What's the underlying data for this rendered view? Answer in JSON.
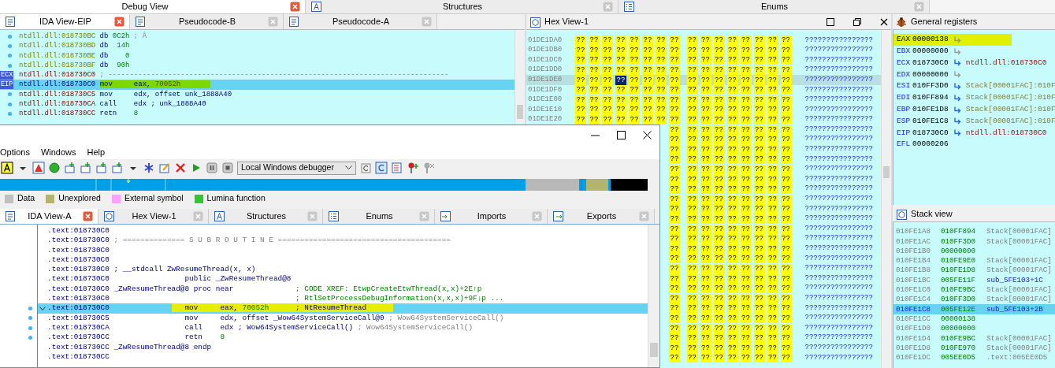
{
  "top_tabs": [
    {
      "label": "Debug View",
      "kind": "none",
      "selected": true
    },
    {
      "label": "Structures",
      "kind": "structures",
      "selected": false
    },
    {
      "label": "Enums",
      "kind": "enums",
      "selected": false
    }
  ],
  "eip_view": {
    "tabs": [
      {
        "label": "IDA View-EIP",
        "kind": "disassembly",
        "selected": true
      },
      {
        "label": "Pseudocode-B",
        "kind": "disassembly",
        "selected": false
      },
      {
        "label": "Pseudocode-A",
        "kind": "disassembly",
        "selected": false
      }
    ],
    "lines": [
      {
        "dot": true,
        "current": false,
        "parts": [
          {
            "text": "ntdll.dll:018730BC",
            "kind": "addrdata"
          },
          {
            "text": " db ",
            "kind": "keyword"
          },
          {
            "text": "0C2h",
            "kind": "number"
          },
          {
            "text": " ; Â",
            "kind": "comment"
          }
        ]
      },
      {
        "dot": true,
        "current": false,
        "parts": [
          {
            "text": "ntdll.dll:018730BD",
            "kind": "addrdata"
          },
          {
            "text": " db  ",
            "kind": "keyword"
          },
          {
            "text": "14h",
            "kind": "number"
          }
        ]
      },
      {
        "dot": true,
        "current": false,
        "parts": [
          {
            "text": "ntdll.dll:018730BE",
            "kind": "addrdata"
          },
          {
            "text": " db    ",
            "kind": "keyword"
          },
          {
            "text": "0",
            "kind": "number"
          }
        ]
      },
      {
        "dot": true,
        "current": false,
        "parts": [
          {
            "text": "ntdll.dll:018730BF",
            "kind": "addrdata"
          },
          {
            "text": " db  ",
            "kind": "keyword"
          },
          {
            "text": "90h",
            "kind": "number"
          }
        ]
      },
      {
        "dot": false,
        "register_label": "ECX",
        "current": false,
        "parts": [
          {
            "text": "ntdll.dll:018730C0",
            "kind": "addrcode"
          },
          {
            "text": " ; --------------------------------------------------------------------------------",
            "kind": "comment"
          }
        ]
      },
      {
        "dot": false,
        "register_label": "EIP",
        "current": true,
        "parts": [
          {
            "text": "ntdll.dll:018730C0 ",
            "kind": "addrcur"
          },
          {
            "text": "mov     eax, ",
            "kind": "keywordmarked"
          },
          {
            "text": "70052h       ",
            "kind": "numbermarked"
          }
        ]
      },
      {
        "dot": true,
        "current": false,
        "parts": [
          {
            "text": "ntdll.dll:018730C5",
            "kind": "addrcode"
          },
          {
            "text": " mov     edx, offset unk_1888A40",
            "kind": "keyword"
          }
        ]
      },
      {
        "dot": true,
        "current": false,
        "parts": [
          {
            "text": "ntdll.dll:018730CA",
            "kind": "addrcode"
          },
          {
            "text": " call    edx ; unk_1888A40",
            "kind": "keyword"
          }
        ]
      },
      {
        "dot": true,
        "current": false,
        "parts": [
          {
            "text": "ntdll.dll:018730CC",
            "kind": "addrcode"
          },
          {
            "text": " retn    ",
            "kind": "keyword"
          },
          {
            "text": "8",
            "kind": "number"
          }
        ]
      }
    ]
  },
  "hex_view": {
    "title": "Hex View-1",
    "rows": [
      {
        "address": "01DE1DA0",
        "current": false,
        "ascii": "????????????????",
        "bytes": [
          {
            "t": "??",
            "selected": false
          },
          {
            "t": "??",
            "selected": false
          },
          {
            "t": "??",
            "selected": false
          },
          {
            "t": "??",
            "selected": false
          },
          {
            "t": "??",
            "selected": false
          },
          {
            "t": "??",
            "selected": false
          },
          {
            "t": "??",
            "selected": false
          },
          {
            "t": "??",
            "selected": false
          },
          {
            "t": "??",
            "selected": false
          },
          {
            "t": "??",
            "selected": false
          },
          {
            "t": "??",
            "selected": false
          },
          {
            "t": "??",
            "selected": false
          },
          {
            "t": "??",
            "selected": false
          },
          {
            "t": "??",
            "selected": false
          },
          {
            "t": "??",
            "selected": false
          },
          {
            "t": "??",
            "selected": false
          }
        ]
      },
      {
        "address": "01DE1DB0",
        "current": false,
        "ascii": "????????????????",
        "bytes": [
          {
            "t": "??",
            "selected": false
          },
          {
            "t": "??",
            "selected": false
          },
          {
            "t": "??",
            "selected": false
          },
          {
            "t": "??",
            "selected": false
          },
          {
            "t": "??",
            "selected": false
          },
          {
            "t": "??",
            "selected": false
          },
          {
            "t": "??",
            "selected": false
          },
          {
            "t": "??",
            "selected": false
          },
          {
            "t": "??",
            "selected": false
          },
          {
            "t": "??",
            "selected": false
          },
          {
            "t": "??",
            "selected": false
          },
          {
            "t": "??",
            "selected": false
          },
          {
            "t": "??",
            "selected": false
          },
          {
            "t": "??",
            "selected": false
          },
          {
            "t": "??",
            "selected": false
          },
          {
            "t": "??",
            "selected": false
          }
        ]
      },
      {
        "address": "01DE1DC0",
        "current": false,
        "ascii": "????????????????",
        "bytes": [
          {
            "t": "??",
            "selected": false
          },
          {
            "t": "??",
            "selected": false
          },
          {
            "t": "??",
            "selected": false
          },
          {
            "t": "??",
            "selected": false
          },
          {
            "t": "??",
            "selected": false
          },
          {
            "t": "??",
            "selected": false
          },
          {
            "t": "??",
            "selected": false
          },
          {
            "t": "??",
            "selected": false
          },
          {
            "t": "??",
            "selected": false
          },
          {
            "t": "??",
            "selected": false
          },
          {
            "t": "??",
            "selected": false
          },
          {
            "t": "??",
            "selected": false
          },
          {
            "t": "??",
            "selected": false
          },
          {
            "t": "??",
            "selected": false
          },
          {
            "t": "??",
            "selected": false
          },
          {
            "t": "??",
            "selected": false
          }
        ]
      },
      {
        "address": "01DE1DD0",
        "current": false,
        "ascii": "????????????????",
        "bytes": [
          {
            "t": "??",
            "selected": false
          },
          {
            "t": "??",
            "selected": false
          },
          {
            "t": "??",
            "selected": false
          },
          {
            "t": "??",
            "selected": false
          },
          {
            "t": "??",
            "selected": false
          },
          {
            "t": "??",
            "selected": false
          },
          {
            "t": "??",
            "selected": false
          },
          {
            "t": "??",
            "selected": false
          },
          {
            "t": "??",
            "selected": false
          },
          {
            "t": "??",
            "selected": false
          },
          {
            "t": "??",
            "selected": false
          },
          {
            "t": "??",
            "selected": false
          },
          {
            "t": "??",
            "selected": false
          },
          {
            "t": "??",
            "selected": false
          },
          {
            "t": "??",
            "selected": false
          },
          {
            "t": "??",
            "selected": false
          }
        ]
      },
      {
        "address": "01DE1DE0",
        "current": true,
        "ascii": "????????????????",
        "bytes": [
          {
            "t": "??",
            "selected": false
          },
          {
            "t": "??",
            "selected": false
          },
          {
            "t": "??",
            "selected": false
          },
          {
            "t": "??",
            "selected": true
          },
          {
            "t": "??",
            "selected": false
          },
          {
            "t": "??",
            "selected": false
          },
          {
            "t": "??",
            "selected": false
          },
          {
            "t": "??",
            "selected": false
          },
          {
            "t": "??",
            "selected": false
          },
          {
            "t": "??",
            "selected": false
          },
          {
            "t": "??",
            "selected": false
          },
          {
            "t": "??",
            "selected": false
          },
          {
            "t": "??",
            "selected": false
          },
          {
            "t": "??",
            "selected": false
          },
          {
            "t": "??",
            "selected": false
          },
          {
            "t": "??",
            "selected": false
          }
        ]
      },
      {
        "address": "01DE1DF0",
        "current": false,
        "ascii": "????????????????",
        "bytes": [
          {
            "t": "??",
            "selected": false
          },
          {
            "t": "??",
            "selected": false
          },
          {
            "t": "??",
            "selected": false
          },
          {
            "t": "??",
            "selected": false
          },
          {
            "t": "??",
            "selected": false
          },
          {
            "t": "??",
            "selected": false
          },
          {
            "t": "??",
            "selected": false
          },
          {
            "t": "??",
            "selected": false
          },
          {
            "t": "??",
            "selected": false
          },
          {
            "t": "??",
            "selected": false
          },
          {
            "t": "??",
            "selected": false
          },
          {
            "t": "??",
            "selected": false
          },
          {
            "t": "??",
            "selected": false
          },
          {
            "t": "??",
            "selected": false
          },
          {
            "t": "??",
            "selected": false
          },
          {
            "t": "??",
            "selected": false
          }
        ]
      },
      {
        "address": "01DE1E00",
        "current": false,
        "ascii": "????????????????",
        "bytes": [
          {
            "t": "??",
            "selected": false
          },
          {
            "t": "??",
            "selected": false
          },
          {
            "t": "??",
            "selected": false
          },
          {
            "t": "??",
            "selected": false
          },
          {
            "t": "??",
            "selected": false
          },
          {
            "t": "??",
            "selected": false
          },
          {
            "t": "??",
            "selected": false
          },
          {
            "t": "??",
            "selected": false
          },
          {
            "t": "??",
            "selected": false
          },
          {
            "t": "??",
            "selected": false
          },
          {
            "t": "??",
            "selected": false
          },
          {
            "t": "??",
            "selected": false
          },
          {
            "t": "??",
            "selected": false
          },
          {
            "t": "??",
            "selected": false
          },
          {
            "t": "??",
            "selected": false
          },
          {
            "t": "??",
            "selected": false
          }
        ]
      },
      {
        "address": "01DE1E10",
        "current": false,
        "ascii": "????????????????",
        "bytes": [
          {
            "t": "??",
            "selected": false
          },
          {
            "t": "??",
            "selected": false
          },
          {
            "t": "??",
            "selected": false
          },
          {
            "t": "??",
            "selected": false
          },
          {
            "t": "??",
            "selected": false
          },
          {
            "t": "??",
            "selected": false
          },
          {
            "t": "??",
            "selected": false
          },
          {
            "t": "??",
            "selected": false
          },
          {
            "t": "??",
            "selected": false
          },
          {
            "t": "??",
            "selected": false
          },
          {
            "t": "??",
            "selected": false
          },
          {
            "t": "??",
            "selected": false
          },
          {
            "t": "??",
            "selected": false
          },
          {
            "t": "??",
            "selected": false
          },
          {
            "t": "??",
            "selected": false
          },
          {
            "t": "??",
            "selected": false
          }
        ]
      },
      {
        "address": "01DE1E20",
        "current": false,
        "ascii": "????????????????",
        "bytes": [
          {
            "t": "??",
            "selected": false
          },
          {
            "t": "??",
            "selected": false
          },
          {
            "t": "??",
            "selected": false
          },
          {
            "t": "??",
            "selected": false
          },
          {
            "t": "??",
            "selected": false
          },
          {
            "t": "??",
            "selected": false
          },
          {
            "t": "??",
            "selected": false
          },
          {
            "t": "??",
            "selected": false
          },
          {
            "t": "??",
            "selected": false
          },
          {
            "t": "??",
            "selected": false
          },
          {
            "t": "??",
            "selected": false
          },
          {
            "t": "??",
            "selected": false
          },
          {
            "t": "??",
            "selected": false
          },
          {
            "t": "??",
            "selected": false
          },
          {
            "t": "??",
            "selected": false
          },
          {
            "t": "??",
            "selected": false
          }
        ]
      }
    ],
    "partial_rows": [
      {
        "ascii": "????????????????",
        "bytes": [
          "??",
          "??",
          "??",
          "??",
          "??",
          "??",
          "??",
          "??",
          "??"
        ]
      },
      {
        "ascii": "????????????????",
        "bytes": [
          "??",
          "??",
          "??",
          "??",
          "??",
          "??",
          "??",
          "??",
          "??"
        ]
      },
      {
        "ascii": "????????????????",
        "bytes": [
          "??",
          "??",
          "??",
          "??",
          "??",
          "??",
          "??",
          "??",
          "??"
        ]
      },
      {
        "ascii": "????????????????",
        "bytes": [
          "??",
          "??",
          "??",
          "??",
          "??",
          "??",
          "??",
          "??",
          "??"
        ]
      },
      {
        "ascii": "????????????????",
        "bytes": [
          "??",
          "??",
          "??",
          "??",
          "??",
          "??",
          "??",
          "??",
          "??"
        ]
      },
      {
        "ascii": "????????????????",
        "bytes": [
          "??",
          "??",
          "??",
          "??",
          "??",
          "??",
          "??",
          "??",
          "??"
        ]
      },
      {
        "ascii": "????????????????",
        "bytes": [
          "??",
          "??",
          "??",
          "??",
          "??",
          "??",
          "??",
          "??",
          "??"
        ]
      },
      {
        "ascii": "????????????????",
        "bytes": [
          "??",
          "??",
          "??",
          "??",
          "??",
          "??",
          "??",
          "??",
          "??"
        ]
      },
      {
        "ascii": "????????????????",
        "bytes": [
          "??",
          "??",
          "??",
          "??",
          "??",
          "??",
          "??",
          "??",
          "??"
        ]
      },
      {
        "ascii": "????????????????",
        "bytes": [
          "??",
          "??",
          "??",
          "??",
          "??",
          "??",
          "??",
          "??",
          "??"
        ]
      },
      {
        "ascii": "????????????????",
        "bytes": [
          "??",
          "??",
          "??",
          "??",
          "??",
          "??",
          "??",
          "??",
          "??"
        ]
      },
      {
        "ascii": "????????????????",
        "bytes": [
          "??",
          "??",
          "??",
          "??",
          "??",
          "??",
          "??",
          "??",
          "??"
        ]
      },
      {
        "ascii": "????????????????",
        "bytes": [
          "??",
          "??",
          "??",
          "??",
          "??",
          "??",
          "??",
          "??",
          "??"
        ]
      },
      {
        "ascii": "????????????????",
        "bytes": [
          "??",
          "??",
          "??",
          "??",
          "??",
          "??",
          "??",
          "??",
          "??"
        ]
      },
      {
        "ascii": "????????????????",
        "bytes": [
          "??",
          "??",
          "??",
          "??",
          "??",
          "??",
          "??",
          "??",
          "??"
        ]
      },
      {
        "ascii": "????????????????",
        "bytes": [
          "??",
          "??",
          "??",
          "??",
          "??",
          "??",
          "??",
          "??",
          "??"
        ]
      },
      {
        "ascii": "????????????????",
        "bytes": [
          "??",
          "??",
          "??",
          "??",
          "??",
          "??",
          "??",
          "??",
          "??"
        ]
      },
      {
        "ascii": "????????????????",
        "bytes": [
          "??",
          "??",
          "??",
          "??",
          "??",
          "??",
          "??",
          "??",
          "??"
        ]
      },
      {
        "ascii": "????????????????",
        "bytes": [
          "??",
          "??",
          "??",
          "??",
          "??",
          "??",
          "??",
          "??",
          "??"
        ]
      },
      {
        "ascii": "????????????????",
        "bytes": [
          "??",
          "??",
          "??",
          "??",
          "??",
          "??",
          "??",
          "??",
          "??"
        ]
      },
      {
        "ascii": "????????????????",
        "bytes": [
          "??",
          "??",
          "??",
          "??",
          "??",
          "??",
          "??",
          "??",
          "??"
        ]
      },
      {
        "ascii": "????????????????",
        "bytes": [
          "??",
          "??",
          "??",
          "??",
          "??",
          "??",
          "??",
          "??",
          "??"
        ]
      },
      {
        "ascii": "????????????????",
        "bytes": [
          "??",
          "??",
          "??",
          "??",
          "??",
          "??",
          "??",
          "??",
          "??"
        ]
      },
      {
        "ascii": "????????????????",
        "bytes": [
          "??",
          "??",
          "??",
          "??",
          "??",
          "??",
          "??",
          "??",
          "??"
        ]
      }
    ]
  },
  "registers": {
    "title": "General registers",
    "rows": [
      {
        "name": "EAX",
        "value": "00000138",
        "changed": true,
        "kind": "plain"
      },
      {
        "name": "EBX",
        "value": "00000000",
        "changed": false,
        "kind": "plain"
      },
      {
        "name": "ECX",
        "value": "018730C0",
        "changed": false,
        "kind": "code",
        "target": "ntdll.dll:018730C0"
      },
      {
        "name": "EDX",
        "value": "00000000",
        "changed": false,
        "kind": "plain"
      },
      {
        "name": "ESI",
        "value": "010FF3D0",
        "changed": false,
        "kind": "stack",
        "target": "Stack[00001FAC]:010F"
      },
      {
        "name": "EDI",
        "value": "010FF894",
        "changed": false,
        "kind": "stack",
        "target": "Stack[00001FAC]:010F"
      },
      {
        "name": "EBP",
        "value": "010FE1D8",
        "changed": false,
        "kind": "stack",
        "target": "Stack[00001FAC]:010F"
      },
      {
        "name": "ESP",
        "value": "010FE1C8",
        "changed": false,
        "kind": "stack",
        "target": "Stack[00001FAC]:010F"
      },
      {
        "name": "EIP",
        "value": "018730C0",
        "changed": false,
        "kind": "code",
        "target": "ntdll.dll:018730C0"
      },
      {
        "name": "EFL",
        "value": "00000206",
        "changed": false,
        "kind": "flags"
      }
    ]
  },
  "stack_view": {
    "title": "Stack view",
    "rows": [
      {
        "address": "010FE1A8",
        "value": "010FF894",
        "comment": "Stack[00001FAC]",
        "kind": "stack",
        "selected": false
      },
      {
        "address": "010FE1AC",
        "value": "010FF3D0",
        "comment": "Stack[00001FAC]",
        "kind": "stack",
        "selected": false
      },
      {
        "address": "010FE1B0",
        "value": "00000000",
        "selected": false
      },
      {
        "address": "010FE1B4",
        "value": "010FE9E0",
        "comment": "Stack[00001FAC]",
        "kind": "stack",
        "selected": false
      },
      {
        "address": "010FE1B8",
        "value": "010FE1D8",
        "comment": "Stack[00001FAC]",
        "kind": "stack",
        "selected": false
      },
      {
        "address": "010FE1BC",
        "value": "005FE11F",
        "comment": "sub_5FE103+1C",
        "kind": "code",
        "selected": false
      },
      {
        "address": "010FE1C0",
        "value": "010FE9BC",
        "comment": "Stack[00001FAC]",
        "kind": "stack",
        "selected": false
      },
      {
        "address": "010FE1C4",
        "value": "010FF3D0",
        "comment": "Stack[00001FAC]",
        "kind": "stack",
        "selected": false
      },
      {
        "address": "010FE1C8",
        "value": "005FE12E",
        "comment": "sub_5FE103+2B",
        "kind": "code",
        "selected": true
      },
      {
        "address": "010FE1CC",
        "value": "00000138",
        "selected": false
      },
      {
        "address": "010FE1D0",
        "value": "00000000",
        "selected": false
      },
      {
        "address": "010FE1D4",
        "value": "010FE9BC",
        "comment": "Stack[00001FAC]",
        "kind": "stack",
        "selected": false
      },
      {
        "address": "010FE1D8",
        "value": "010FE970",
        "comment": "Stack[00001FAC]",
        "kind": "stack",
        "selected": false
      },
      {
        "address": "010FE1DC",
        "value": "005EE0D5",
        "comment": ".text:005EE0D5",
        "kind": "segment",
        "selected": false
      }
    ]
  },
  "front_window": {
    "menu": [
      "Options",
      "Windows",
      "Help"
    ],
    "debugger_select": {
      "value": "Local Windows debugger"
    },
    "legend": [
      {
        "label": "Data",
        "color": "#c0c0c0"
      },
      {
        "label": "Unexplored",
        "color": "#b4b46c"
      },
      {
        "label": "External symbol",
        "color": "#ffa0ff"
      },
      {
        "label": "Lumina function",
        "color": "#30c830"
      }
    ],
    "tabs": [
      {
        "label": "IDA View-A",
        "kind": "disassembly",
        "selected": true
      },
      {
        "label": "Hex View-1",
        "kind": "hex",
        "selected": false
      },
      {
        "label": "Structures",
        "kind": "structures",
        "selected": false
      },
      {
        "label": "Enums",
        "kind": "enums",
        "selected": false
      },
      {
        "label": "Imports",
        "kind": "imports",
        "selected": false
      },
      {
        "label": "Exports",
        "kind": "exports",
        "selected": false
      }
    ],
    "lines": [
      {
        "dot": false,
        "current": false,
        "parts": [
          {
            "text": ".text:018730C0",
            "kind": "addr"
          }
        ]
      },
      {
        "dot": false,
        "current": false,
        "parts": [
          {
            "text": ".text:018730C0",
            "kind": "addr"
          },
          {
            "text": " ; ============== S U B R O U T I N E =======================================",
            "kind": "comment"
          }
        ]
      },
      {
        "dot": false,
        "current": false,
        "parts": [
          {
            "text": ".text:018730C0",
            "kind": "addr"
          }
        ]
      },
      {
        "dot": false,
        "current": false,
        "parts": [
          {
            "text": ".text:018730C0",
            "kind": "addr"
          }
        ]
      },
      {
        "dot": false,
        "current": false,
        "parts": [
          {
            "text": ".text:018730C0",
            "kind": "addr"
          },
          {
            "text": " ; __stdcall ZwResumeThread(x, x)",
            "kind": "keyword"
          }
        ]
      },
      {
        "dot": false,
        "current": false,
        "parts": [
          {
            "text": ".text:018730C0",
            "kind": "addr"
          },
          {
            "text": "                 public _ZwResumeThread@8",
            "kind": "keyword"
          }
        ]
      },
      {
        "dot": false,
        "current": false,
        "parts": [
          {
            "text": ".text:018730C0",
            "kind": "addr"
          },
          {
            "text": " _ZwResumeThread@8 proc near              ",
            "kind": "keyword"
          },
          {
            "text": "; CODE XREF: EtwpCreateEtwThread(x,x)+2E↑p",
            "kind": "xref"
          }
        ]
      },
      {
        "dot": false,
        "current": false,
        "parts": [
          {
            "text": ".text:018730C0",
            "kind": "addr"
          },
          {
            "text": "                                          ; RtlSetProcessDebugInformation(x,x,x)+9F↓p ...",
            "kind": "xref"
          }
        ]
      },
      {
        "dot": true,
        "current": true,
        "expanded": true,
        "parts": [
          {
            "text": ".text:018730C0              ",
            "kind": "addr"
          },
          {
            "text": "   mov     eax, ",
            "kind": "keywordmarked"
          },
          {
            "text": "70052h",
            "kind": "numbermarked"
          },
          {
            "text": "      ; NtResumeThread      ",
            "kind": "keywordmarked"
          }
        ]
      },
      {
        "dot": true,
        "current": false,
        "parts": [
          {
            "text": ".text:018730C5",
            "kind": "addr"
          },
          {
            "text": "                 mov     edx, offset _Wow64SystemServiceCall@0",
            "kind": "keyword"
          },
          {
            "text": " ; Wow64SystemServiceCall()",
            "kind": "comment"
          }
        ]
      },
      {
        "dot": true,
        "current": false,
        "parts": [
          {
            "text": ".text:018730CA",
            "kind": "addr"
          },
          {
            "text": "                 call    edx ; Wow64SystemServiceCall()",
            "kind": "keyword"
          },
          {
            "text": " ; Wow64SystemServiceCall()",
            "kind": "comment"
          }
        ]
      },
      {
        "dot": true,
        "current": false,
        "parts": [
          {
            "text": ".text:018730CC",
            "kind": "addr"
          },
          {
            "text": "                 retn    ",
            "kind": "keyword"
          },
          {
            "text": "8",
            "kind": "number"
          }
        ]
      },
      {
        "dot": false,
        "current": false,
        "parts": [
          {
            "text": ".text:018730CC",
            "kind": "addr"
          },
          {
            "text": " _ZwResumeThread@8 endp",
            "kind": "keyword"
          }
        ]
      },
      {
        "dot": false,
        "current": false,
        "parts": [
          {
            "text": ".text:018730CC",
            "kind": "addr"
          }
        ]
      }
    ]
  }
}
